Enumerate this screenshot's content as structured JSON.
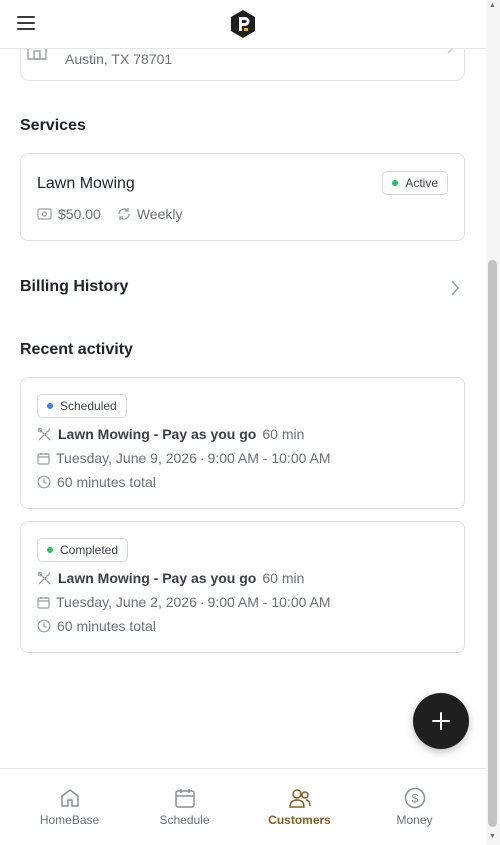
{
  "header": {
    "menu_icon": "hamburger-icon",
    "logo_icon": "app-logo"
  },
  "address": {
    "line2": "Austin, TX 78701"
  },
  "services": {
    "title": "Services",
    "item": {
      "name": "Lawn Mowing",
      "status": "Active",
      "status_color": "#22c55e",
      "price": "$50.00",
      "frequency": "Weekly"
    }
  },
  "billing": {
    "title": "Billing History"
  },
  "activity": {
    "title": "Recent activity",
    "items": [
      {
        "status": "Scheduled",
        "status_color": "#3b82f6",
        "service": "Lawn Mowing - Pay as you go",
        "duration": "60 min",
        "date": "Tuesday, June 9, 2026",
        "separator": "·",
        "time": "9:00 AM - 10:00 AM",
        "total": "60 minutes total"
      },
      {
        "status": "Completed",
        "status_color": "#22c55e",
        "service": "Lawn Mowing - Pay as you go",
        "duration": "60 min",
        "date": "Tuesday, June 2, 2026",
        "separator": "·",
        "time": "9:00 AM - 10:00 AM",
        "total": "60 minutes total"
      }
    ]
  },
  "fab": {
    "icon": "plus-icon"
  },
  "nav": {
    "active_color": "#8a5a1d",
    "items": [
      {
        "label": "HomeBase",
        "icon": "home-icon"
      },
      {
        "label": "Schedule",
        "icon": "calendar-icon"
      },
      {
        "label": "Customers",
        "icon": "users-icon"
      },
      {
        "label": "Money",
        "icon": "dollar-circle-icon"
      }
    ]
  }
}
